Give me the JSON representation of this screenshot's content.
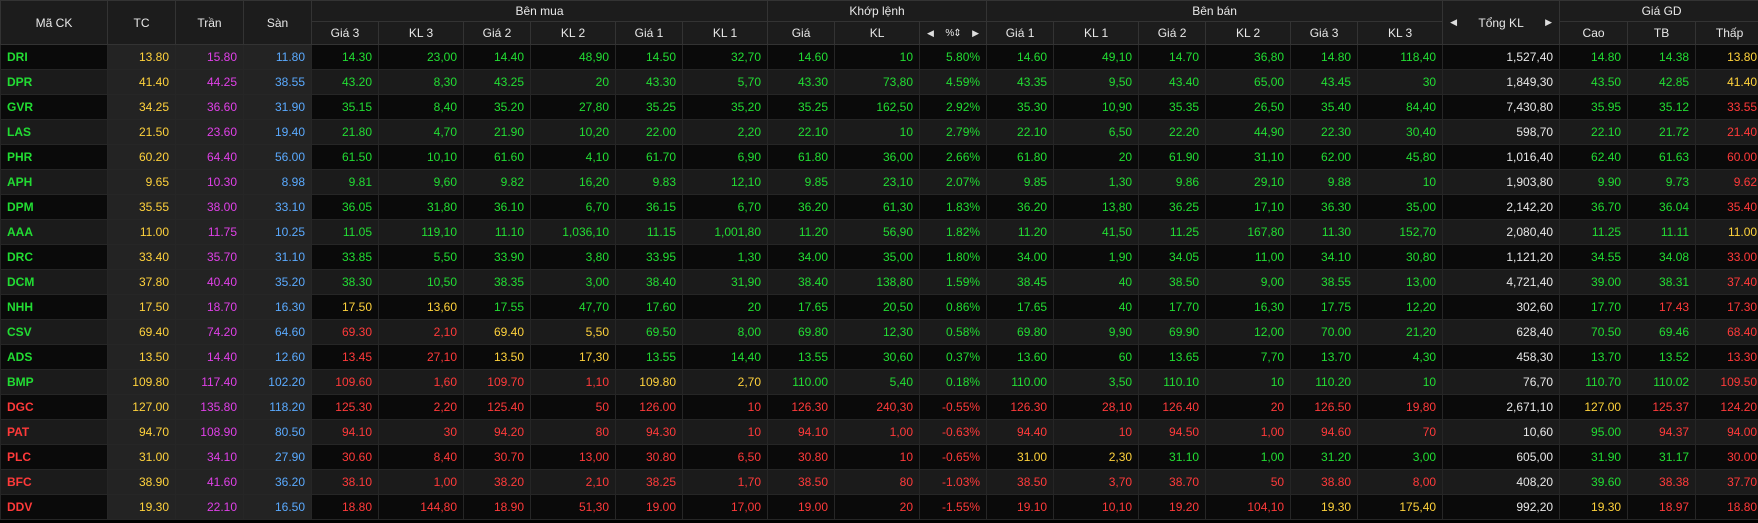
{
  "headers": {
    "symbol": "Mã CK",
    "ref": "TC",
    "ceiling": "Trần",
    "floor": "Sàn",
    "buy_group": "Bên mua",
    "match_group": "Khớp lệnh",
    "sell_group": "Bên bán",
    "total_vol": "Tổng KL",
    "price_group": "Giá GD",
    "price3": "Giá 3",
    "vol3": "KL 3",
    "price2": "Giá 2",
    "vol2": "KL 2",
    "price1": "Giá 1",
    "vol1": "KL 1",
    "match_price": "Giá",
    "match_vol": "KL",
    "match_pct": "%",
    "high": "Cao",
    "avg": "TB",
    "low": "Thấp"
  },
  "icons": {
    "left": "triangle-left-icon",
    "right": "triangle-right-icon",
    "sort": "sort-icon"
  },
  "colors": {
    "up": "#22dd33",
    "down": "#ff3a3a",
    "ref": "#ffd23c",
    "ceiling": "#e040e8",
    "floor": "#5aaaff"
  },
  "rows": [
    {
      "s": "DRI",
      "tc": "13.80",
      "tr": "15.80",
      "sa": "11.80",
      "b": [
        [
          "14.30",
          "23,00"
        ],
        [
          "14.40",
          "48,90"
        ],
        [
          "14.50",
          "32,70"
        ]
      ],
      "m": [
        "14.60",
        "10",
        "5.80%"
      ],
      "a": [
        [
          "14.60",
          "49,10"
        ],
        [
          "14.70",
          "36,80"
        ],
        [
          "14.80",
          "118,40"
        ]
      ],
      "t": "1,527,40",
      "h": "14.80",
      "avg": "14.38",
      "l": "13.80"
    },
    {
      "s": "DPR",
      "tc": "41.40",
      "tr": "44.25",
      "sa": "38.55",
      "b": [
        [
          "43.20",
          "8,30"
        ],
        [
          "43.25",
          "20"
        ],
        [
          "43.30",
          "5,70"
        ]
      ],
      "m": [
        "43.30",
        "73,80",
        "4.59%"
      ],
      "a": [
        [
          "43.35",
          "9,50"
        ],
        [
          "43.40",
          "65,00"
        ],
        [
          "43.45",
          "30"
        ]
      ],
      "t": "1,849,30",
      "h": "43.50",
      "avg": "42.85",
      "l": "41.40"
    },
    {
      "s": "GVR",
      "tc": "34.25",
      "tr": "36.60",
      "sa": "31.90",
      "b": [
        [
          "35.15",
          "8,40"
        ],
        [
          "35.20",
          "27,80"
        ],
        [
          "35.25",
          "35,20"
        ]
      ],
      "m": [
        "35.25",
        "162,50",
        "2.92%"
      ],
      "a": [
        [
          "35.30",
          "10,90"
        ],
        [
          "35.35",
          "26,50"
        ],
        [
          "35.40",
          "84,40"
        ]
      ],
      "t": "7,430,80",
      "h": "35.95",
      "avg": "35.12",
      "l": "33.55"
    },
    {
      "s": "LAS",
      "tc": "21.50",
      "tr": "23.60",
      "sa": "19.40",
      "b": [
        [
          "21.80",
          "4,70"
        ],
        [
          "21.90",
          "10,20"
        ],
        [
          "22.00",
          "2,20"
        ]
      ],
      "m": [
        "22.10",
        "10",
        "2.79%"
      ],
      "a": [
        [
          "22.10",
          "6,50"
        ],
        [
          "22.20",
          "44,90"
        ],
        [
          "22.30",
          "30,40"
        ]
      ],
      "t": "598,70",
      "h": "22.10",
      "avg": "21.72",
      "l": "21.40"
    },
    {
      "s": "PHR",
      "tc": "60.20",
      "tr": "64.40",
      "sa": "56.00",
      "b": [
        [
          "61.50",
          "10,10"
        ],
        [
          "61.60",
          "4,10"
        ],
        [
          "61.70",
          "6,90"
        ]
      ],
      "m": [
        "61.80",
        "36,00",
        "2.66%"
      ],
      "a": [
        [
          "61.80",
          "20"
        ],
        [
          "61.90",
          "31,10"
        ],
        [
          "62.00",
          "45,80"
        ]
      ],
      "t": "1,016,40",
      "h": "62.40",
      "avg": "61.63",
      "l": "60.00"
    },
    {
      "s": "APH",
      "tc": "9.65",
      "tr": "10.30",
      "sa": "8.98",
      "b": [
        [
          "9.81",
          "9,60"
        ],
        [
          "9.82",
          "16,20"
        ],
        [
          "9.83",
          "12,10"
        ]
      ],
      "m": [
        "9.85",
        "23,10",
        "2.07%"
      ],
      "a": [
        [
          "9.85",
          "1,30"
        ],
        [
          "9.86",
          "29,10"
        ],
        [
          "9.88",
          "10"
        ]
      ],
      "t": "1,903,80",
      "h": "9.90",
      "avg": "9.73",
      "l": "9.62"
    },
    {
      "s": "DPM",
      "tc": "35.55",
      "tr": "38.00",
      "sa": "33.10",
      "b": [
        [
          "36.05",
          "31,80"
        ],
        [
          "36.10",
          "6,70"
        ],
        [
          "36.15",
          "6,70"
        ]
      ],
      "m": [
        "36.20",
        "61,30",
        "1.83%"
      ],
      "a": [
        [
          "36.20",
          "13,80"
        ],
        [
          "36.25",
          "17,10"
        ],
        [
          "36.30",
          "35,00"
        ]
      ],
      "t": "2,142,20",
      "h": "36.70",
      "avg": "36.04",
      "l": "35.40"
    },
    {
      "s": "AAA",
      "tc": "11.00",
      "tr": "11.75",
      "sa": "10.25",
      "b": [
        [
          "11.05",
          "119,10"
        ],
        [
          "11.10",
          "1,036,10"
        ],
        [
          "11.15",
          "1,001,80"
        ]
      ],
      "m": [
        "11.20",
        "56,90",
        "1.82%"
      ],
      "a": [
        [
          "11.20",
          "41,50"
        ],
        [
          "11.25",
          "167,80"
        ],
        [
          "11.30",
          "152,70"
        ]
      ],
      "t": "2,080,40",
      "h": "11.25",
      "avg": "11.11",
      "l": "11.00"
    },
    {
      "s": "DRC",
      "tc": "33.40",
      "tr": "35.70",
      "sa": "31.10",
      "b": [
        [
          "33.85",
          "5,50"
        ],
        [
          "33.90",
          "3,80"
        ],
        [
          "33.95",
          "1,30"
        ]
      ],
      "m": [
        "34.00",
        "35,00",
        "1.80%"
      ],
      "a": [
        [
          "34.00",
          "1,90"
        ],
        [
          "34.05",
          "11,00"
        ],
        [
          "34.10",
          "30,80"
        ]
      ],
      "t": "1,121,20",
      "h": "34.55",
      "avg": "34.08",
      "l": "33.00"
    },
    {
      "s": "DCM",
      "tc": "37.80",
      "tr": "40.40",
      "sa": "35.20",
      "b": [
        [
          "38.30",
          "10,50"
        ],
        [
          "38.35",
          "3,00"
        ],
        [
          "38.40",
          "31,90"
        ]
      ],
      "m": [
        "38.40",
        "138,80",
        "1.59%"
      ],
      "a": [
        [
          "38.45",
          "40"
        ],
        [
          "38.50",
          "9,00"
        ],
        [
          "38.55",
          "13,00"
        ]
      ],
      "t": "4,721,40",
      "h": "39.00",
      "avg": "38.31",
      "l": "37.40"
    },
    {
      "s": "NHH",
      "tc": "17.50",
      "tr": "18.70",
      "sa": "16.30",
      "b": [
        [
          "17.50",
          "13,60"
        ],
        [
          "17.55",
          "47,70"
        ],
        [
          "17.60",
          "20"
        ]
      ],
      "m": [
        "17.65",
        "20,50",
        "0.86%"
      ],
      "a": [
        [
          "17.65",
          "40"
        ],
        [
          "17.70",
          "16,30"
        ],
        [
          "17.75",
          "12,20"
        ]
      ],
      "t": "302,60",
      "h": "17.70",
      "avg": "17.43",
      "l": "17.30"
    },
    {
      "s": "CSV",
      "tc": "69.40",
      "tr": "74.20",
      "sa": "64.60",
      "b": [
        [
          "69.30",
          "2,10"
        ],
        [
          "69.40",
          "5,50"
        ],
        [
          "69.50",
          "8,00"
        ]
      ],
      "m": [
        "69.80",
        "12,30",
        "0.58%"
      ],
      "a": [
        [
          "69.80",
          "9,90"
        ],
        [
          "69.90",
          "12,00"
        ],
        [
          "70.00",
          "21,20"
        ]
      ],
      "t": "628,40",
      "h": "70.50",
      "avg": "69.46",
      "l": "68.40"
    },
    {
      "s": "ADS",
      "tc": "13.50",
      "tr": "14.40",
      "sa": "12.60",
      "b": [
        [
          "13.45",
          "27,10"
        ],
        [
          "13.50",
          "17,30"
        ],
        [
          "13.55",
          "14,40"
        ]
      ],
      "m": [
        "13.55",
        "30,60",
        "0.37%"
      ],
      "a": [
        [
          "13.60",
          "60"
        ],
        [
          "13.65",
          "7,70"
        ],
        [
          "13.70",
          "4,30"
        ]
      ],
      "t": "458,30",
      "h": "13.70",
      "avg": "13.52",
      "l": "13.30"
    },
    {
      "s": "BMP",
      "tc": "109.80",
      "tr": "117.40",
      "sa": "102.20",
      "b": [
        [
          "109.60",
          "1,60"
        ],
        [
          "109.70",
          "1,10"
        ],
        [
          "109.80",
          "2,70"
        ]
      ],
      "m": [
        "110.00",
        "5,40",
        "0.18%"
      ],
      "a": [
        [
          "110.00",
          "3,50"
        ],
        [
          "110.10",
          "10"
        ],
        [
          "110.20",
          "10"
        ]
      ],
      "t": "76,70",
      "h": "110.70",
      "avg": "110.02",
      "l": "109.50"
    },
    {
      "s": "DGC",
      "tc": "127.00",
      "tr": "135.80",
      "sa": "118.20",
      "b": [
        [
          "125.30",
          "2,20"
        ],
        [
          "125.40",
          "50"
        ],
        [
          "126.00",
          "10"
        ]
      ],
      "m": [
        "126.30",
        "240,30",
        "-0.55%"
      ],
      "a": [
        [
          "126.30",
          "28,10"
        ],
        [
          "126.40",
          "20"
        ],
        [
          "126.50",
          "19,80"
        ]
      ],
      "t": "2,671,10",
      "h": "127.00",
      "avg": "125.37",
      "l": "124.20"
    },
    {
      "s": "PAT",
      "tc": "94.70",
      "tr": "108.90",
      "sa": "80.50",
      "b": [
        [
          "94.10",
          "30"
        ],
        [
          "94.20",
          "80"
        ],
        [
          "94.30",
          "10"
        ]
      ],
      "m": [
        "94.10",
        "1,00",
        "-0.63%"
      ],
      "a": [
        [
          "94.40",
          "10"
        ],
        [
          "94.50",
          "1,00"
        ],
        [
          "94.60",
          "70"
        ]
      ],
      "t": "10,60",
      "h": "95.00",
      "avg": "94.37",
      "l": "94.00"
    },
    {
      "s": "PLC",
      "tc": "31.00",
      "tr": "34.10",
      "sa": "27.90",
      "b": [
        [
          "30.60",
          "8,40"
        ],
        [
          "30.70",
          "13,00"
        ],
        [
          "30.80",
          "6,50"
        ]
      ],
      "m": [
        "30.80",
        "10",
        "-0.65%"
      ],
      "a": [
        [
          "31.00",
          "2,30"
        ],
        [
          "31.10",
          "1,00"
        ],
        [
          "31.20",
          "3,00"
        ]
      ],
      "t": "605,00",
      "h": "31.90",
      "avg": "31.17",
      "l": "30.00"
    },
    {
      "s": "BFC",
      "tc": "38.90",
      "tr": "41.60",
      "sa": "36.20",
      "b": [
        [
          "38.10",
          "1,00"
        ],
        [
          "38.20",
          "2,10"
        ],
        [
          "38.25",
          "1,70"
        ]
      ],
      "m": [
        "38.50",
        "80",
        "-1.03%"
      ],
      "a": [
        [
          "38.50",
          "3,70"
        ],
        [
          "38.70",
          "50"
        ],
        [
          "38.80",
          "8,00"
        ]
      ],
      "t": "408,20",
      "h": "39.60",
      "avg": "38.38",
      "l": "37.70"
    },
    {
      "s": "DDV",
      "tc": "19.30",
      "tr": "22.10",
      "sa": "16.50",
      "b": [
        [
          "18.80",
          "144,80"
        ],
        [
          "18.90",
          "51,30"
        ],
        [
          "19.00",
          "17,00"
        ]
      ],
      "m": [
        "19.00",
        "20",
        "-1.55%"
      ],
      "a": [
        [
          "19.10",
          "10,10"
        ],
        [
          "19.20",
          "104,10"
        ],
        [
          "19.30",
          "175,40"
        ]
      ],
      "t": "992,20",
      "h": "19.30",
      "avg": "18.97",
      "l": "18.80"
    }
  ]
}
